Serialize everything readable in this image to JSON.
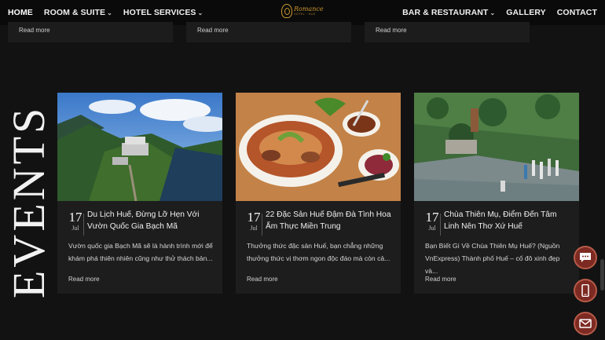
{
  "nav": {
    "left": [
      {
        "label": "HOME",
        "caret": ""
      },
      {
        "label": "ROOM & SUITE",
        "caret": "⌄"
      },
      {
        "label": "HOTEL SERVICES",
        "caret": "⌄"
      }
    ],
    "right": [
      {
        "label": "BAR & RESTAURANT",
        "caret": "⌄"
      },
      {
        "label": "GALLERY",
        "caret": ""
      },
      {
        "label": "CONTACT",
        "caret": ""
      }
    ],
    "logo": {
      "main": "Romance",
      "sub": "HOTEL · HUE"
    }
  },
  "previous_cards": {
    "read_more": "Read more"
  },
  "section": {
    "title": "EVENTS"
  },
  "events": [
    {
      "day": "17",
      "month": "Jul",
      "title": "Du Lịch Huế, Đừng Lỡ Hẹn Với Vườn Quốc Gia Bạch Mã",
      "excerpt": "Vườn quốc gia Bạch Mã sẽ là hành trình mới để khám phá thiên nhiên cũng như thử thách bản...",
      "read_more": "Read more",
      "image": "mountain-resort"
    },
    {
      "day": "17",
      "month": "Jul",
      "title": "22 Đặc Sản Huế Đậm Đà Tình Hoa Ẩm Thực Miền Trung",
      "excerpt": "Thưởng thức đặc sản Huế, bạn chẳng những thưởng thức vị thơm ngon độc đáo mà còn cả...",
      "read_more": "Read more",
      "image": "noodle-bowl"
    },
    {
      "day": "17",
      "month": "Jul",
      "title": "Chùa Thiên Mụ, Điểm Đến Tâm Linh Nên Thơ Xứ Huế",
      "excerpt": "Bạn Biết Gì Về Chùa Thiên Mụ Huế? (Nguồn VnExpress) Thành phố Huế – cố đô xinh đẹp và...",
      "read_more": "Read more",
      "image": "pagoda-river"
    }
  ],
  "floating": [
    {
      "icon": "chat-icon"
    },
    {
      "icon": "phone-icon"
    },
    {
      "icon": "mail-icon"
    }
  ],
  "colors": {
    "background": "#121212",
    "card": "#1d1d1d",
    "gold": "#c8962e",
    "fab": "#7c2a22"
  }
}
